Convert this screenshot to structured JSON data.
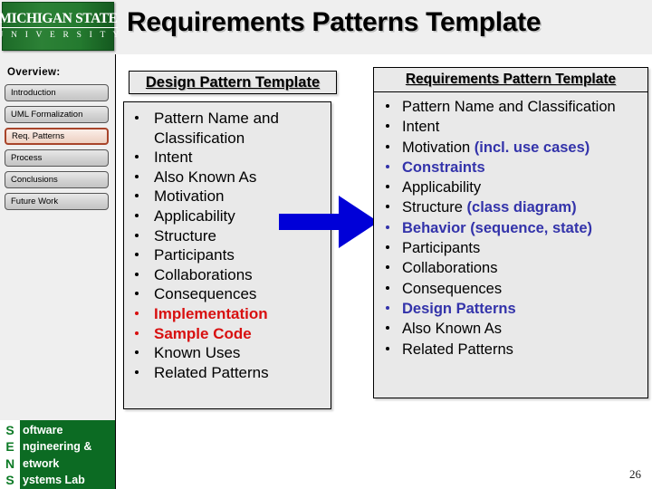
{
  "slide": {
    "title": "Requirements Patterns Template",
    "page_number": "26"
  },
  "logo": {
    "line1": "MICHIGAN STATE",
    "line2": "U N I V E R S I T Y"
  },
  "sidebar": {
    "overview_label": "Overview:",
    "items": [
      {
        "label": "Introduction",
        "active": false
      },
      {
        "label": "UML Formalization",
        "active": false
      },
      {
        "label": "Req. Patterns",
        "active": true
      },
      {
        "label": "Process",
        "active": false
      },
      {
        "label": "Conclusions",
        "active": false
      },
      {
        "label": "Future Work",
        "active": false
      }
    ],
    "active_border_color": "#a8442a"
  },
  "footer": {
    "initials": [
      "S",
      "E",
      "N",
      "S"
    ],
    "words": [
      "oftware",
      "ngineering &",
      "etwork",
      "ystems Lab"
    ],
    "green": "#0c6b23"
  },
  "design_panel": {
    "header": "Design Pattern Template",
    "items": [
      {
        "text": "Pattern Name and Classification",
        "style": "plain"
      },
      {
        "text": "Intent",
        "style": "plain"
      },
      {
        "text": "Also Known As",
        "style": "plain"
      },
      {
        "text": "Motivation",
        "style": "plain"
      },
      {
        "text": "Applicability",
        "style": "plain"
      },
      {
        "text": "Structure",
        "style": "plain"
      },
      {
        "text": "Participants",
        "style": "plain"
      },
      {
        "text": "Collaborations",
        "style": "plain"
      },
      {
        "text": "Consequences",
        "style": "plain"
      },
      {
        "text": "Implementation",
        "style": "red"
      },
      {
        "text": "Sample Code",
        "style": "red"
      },
      {
        "text": "Known Uses",
        "style": "plain"
      },
      {
        "text": "Related Patterns",
        "style": "plain"
      }
    ],
    "highlight_color": "#d81010"
  },
  "requirements_panel": {
    "header": "Requirements Pattern Template",
    "items": [
      {
        "main": "Pattern Name and Classification",
        "extra": "",
        "style": "plain"
      },
      {
        "main": "Intent",
        "extra": "",
        "style": "plain"
      },
      {
        "main": "Motivation ",
        "extra": "(incl. use cases)",
        "style": "extra-blue"
      },
      {
        "main": "Constraints",
        "extra": "",
        "style": "blue"
      },
      {
        "main": "Applicability",
        "extra": "",
        "style": "plain"
      },
      {
        "main": "Structure ",
        "extra": "(class diagram)",
        "style": "extra-blue"
      },
      {
        "main": "Behavior (sequence, state)",
        "extra": "",
        "style": "blue"
      },
      {
        "main": "Participants",
        "extra": "",
        "style": "plain"
      },
      {
        "main": "Collaborations",
        "extra": "",
        "style": "plain"
      },
      {
        "main": "Consequences",
        "extra": "",
        "style": "plain"
      },
      {
        "main": "Design Patterns",
        "extra": "",
        "style": "blue"
      },
      {
        "main": "Also Known As",
        "extra": "",
        "style": "plain"
      },
      {
        "main": "Related Patterns",
        "extra": "",
        "style": "plain"
      }
    ],
    "highlight_color": "#3333aa"
  },
  "arrow": {
    "name": "transformation-arrow",
    "color": "#0000d8",
    "direction": "right"
  }
}
